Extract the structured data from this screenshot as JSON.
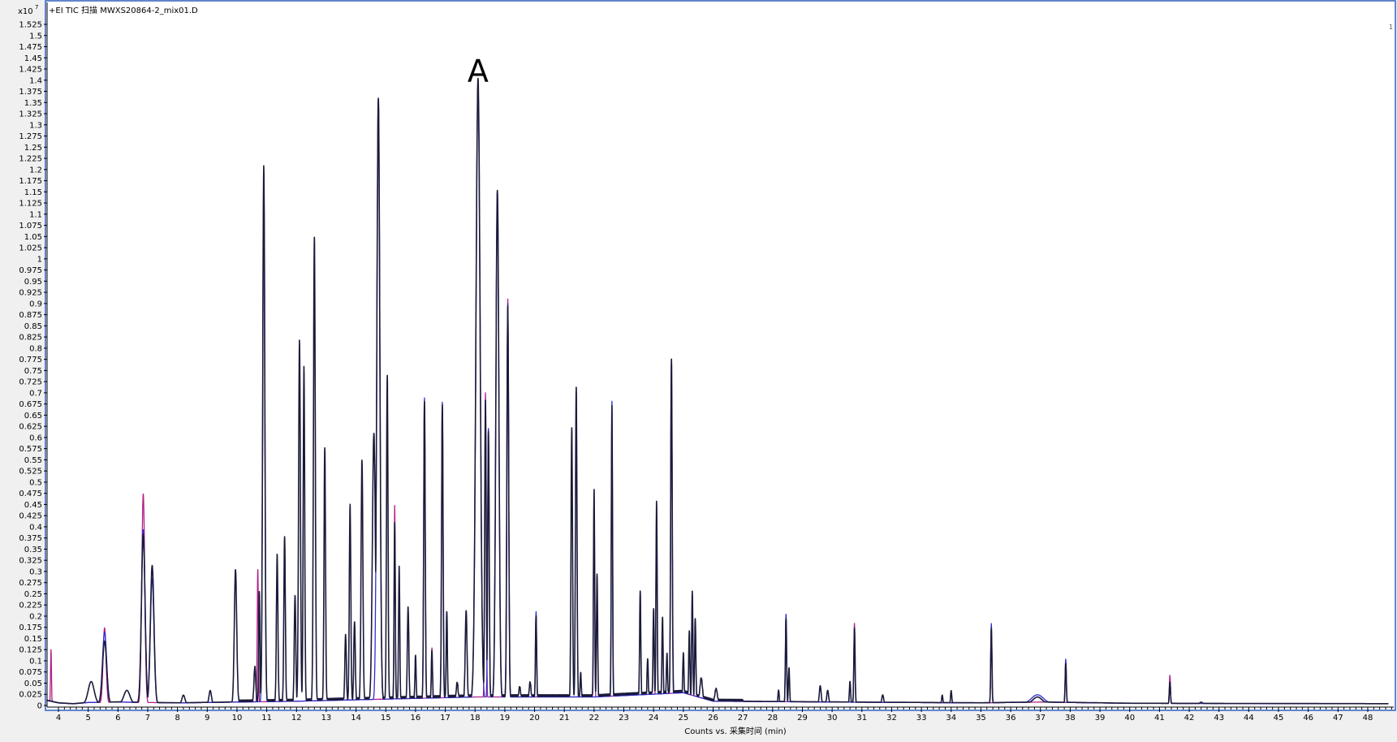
{
  "chart_data": {
    "type": "line",
    "title": "+EI TIC 扫描 MWXS20864-2_mix01.D",
    "xlabel": "Counts vs. 采集时间 (min)",
    "y_exponent_label": "x10",
    "y_exponent": "7",
    "corner_marker": "1",
    "annotation": {
      "text": "A",
      "x": 18.1
    },
    "xlim": [
      3.6,
      48.7
    ],
    "ylim": [
      0,
      1.55
    ],
    "x_ticks": [
      4,
      5,
      6,
      7,
      8,
      9,
      10,
      11,
      12,
      13,
      14,
      15,
      16,
      17,
      18,
      19,
      20,
      21,
      22,
      23,
      24,
      25,
      26,
      27,
      28,
      29,
      30,
      31,
      32,
      33,
      34,
      35,
      36,
      37,
      38,
      39,
      40,
      41,
      42,
      43,
      44,
      45,
      46,
      47,
      48
    ],
    "y_ticks": [
      "0",
      "0.025",
      "0.05",
      "0.075",
      "0.1",
      "0.125",
      "0.15",
      "0.175",
      "0.2",
      "0.225",
      "0.25",
      "0.275",
      "0.3",
      "0.325",
      "0.35",
      "0.375",
      "0.4",
      "0.425",
      "0.45",
      "0.475",
      "0.5",
      "0.525",
      "0.55",
      "0.575",
      "0.6",
      "0.625",
      "0.65",
      "0.675",
      "0.7",
      "0.725",
      "0.75",
      "0.775",
      "0.8",
      "0.825",
      "0.85",
      "0.875",
      "0.9",
      "0.925",
      "0.95",
      "0.975",
      "1",
      "1.025",
      "1.05",
      "1.075",
      "1.1",
      "1.125",
      "1.15",
      "1.175",
      "1.2",
      "1.225",
      "1.25",
      "1.275",
      "1.3",
      "1.325",
      "1.35",
      "1.375",
      "1.4",
      "1.425",
      "1.45",
      "1.475",
      "1.5",
      "1.525"
    ],
    "colors": {
      "trace_dark": "#1a1a3a",
      "trace_blue": "#2d2dcf",
      "trace_magenta": "#b0208a",
      "frame": "#3060c0"
    },
    "baseline": {
      "points": [
        [
          3.6,
          0.012
        ],
        [
          4.0,
          0.006
        ],
        [
          4.5,
          0.004
        ],
        [
          5.0,
          0.007
        ],
        [
          6.0,
          0.008
        ],
        [
          8.0,
          0.006
        ],
        [
          12.0,
          0.01
        ],
        [
          18.0,
          0.02
        ],
        [
          22.0,
          0.02
        ],
        [
          25.0,
          0.03
        ],
        [
          26.0,
          0.01
        ],
        [
          30.0,
          0.008
        ],
        [
          35.0,
          0.006
        ],
        [
          37.0,
          0.008
        ],
        [
          40.0,
          0.005
        ],
        [
          48.7,
          0.004
        ]
      ]
    },
    "series": [
      {
        "color_key": "trace_dark",
        "peaks": [
          [
            5.1,
            0.05,
            0.1
          ],
          [
            5.55,
            0.14,
            0.07
          ],
          [
            6.3,
            0.03,
            0.1
          ],
          [
            6.85,
            0.38,
            0.06
          ],
          [
            7.15,
            0.31,
            0.06
          ],
          [
            8.2,
            0.02,
            0.05
          ],
          [
            9.1,
            0.03,
            0.04
          ],
          [
            9.95,
            0.3,
            0.04
          ],
          [
            10.6,
            0.08,
            0.03
          ],
          [
            10.75,
            0.25,
            0.02
          ],
          [
            10.9,
            1.2,
            0.035
          ],
          [
            11.35,
            0.33,
            0.025
          ],
          [
            11.6,
            0.37,
            0.025
          ],
          [
            11.95,
            0.24,
            0.025
          ],
          [
            12.1,
            0.81,
            0.03
          ],
          [
            12.25,
            0.75,
            0.025
          ],
          [
            12.6,
            1.04,
            0.03
          ],
          [
            12.95,
            0.57,
            0.025
          ],
          [
            13.65,
            0.15,
            0.025
          ],
          [
            13.8,
            0.44,
            0.025
          ],
          [
            13.95,
            0.18,
            0.025
          ],
          [
            14.2,
            0.54,
            0.03
          ],
          [
            14.6,
            0.6,
            0.05
          ],
          [
            14.75,
            1.35,
            0.05
          ],
          [
            15.05,
            0.73,
            0.025
          ],
          [
            15.3,
            0.4,
            0.02
          ],
          [
            15.45,
            0.3,
            0.02
          ],
          [
            15.75,
            0.21,
            0.025
          ],
          [
            16.0,
            0.1,
            0.02
          ],
          [
            16.3,
            0.67,
            0.025
          ],
          [
            16.55,
            0.11,
            0.02
          ],
          [
            16.9,
            0.66,
            0.025
          ],
          [
            17.05,
            0.2,
            0.02
          ],
          [
            17.4,
            0.04,
            0.03
          ],
          [
            17.7,
            0.2,
            0.03
          ],
          [
            18.1,
            1.39,
            0.07
          ],
          [
            18.35,
            0.67,
            0.025
          ],
          [
            18.45,
            0.6,
            0.025
          ],
          [
            18.75,
            1.14,
            0.05
          ],
          [
            19.1,
            0.88,
            0.03
          ],
          [
            19.5,
            0.03,
            0.03
          ],
          [
            19.85,
            0.04,
            0.03
          ],
          [
            20.05,
            0.19,
            0.02
          ],
          [
            21.25,
            0.61,
            0.025
          ],
          [
            21.4,
            0.7,
            0.025
          ],
          [
            21.55,
            0.06,
            0.02
          ],
          [
            22.0,
            0.47,
            0.02
          ],
          [
            22.1,
            0.28,
            0.02
          ],
          [
            22.6,
            0.66,
            0.02
          ],
          [
            23.55,
            0.24,
            0.02
          ],
          [
            23.8,
            0.09,
            0.02
          ],
          [
            24.0,
            0.2,
            0.02
          ],
          [
            24.1,
            0.44,
            0.02
          ],
          [
            24.3,
            0.18,
            0.02
          ],
          [
            24.45,
            0.1,
            0.02
          ],
          [
            24.6,
            0.76,
            0.025
          ],
          [
            25.0,
            0.1,
            0.02
          ],
          [
            25.2,
            0.15,
            0.02
          ],
          [
            25.3,
            0.24,
            0.02
          ],
          [
            25.4,
            0.18,
            0.02
          ],
          [
            25.6,
            0.05,
            0.04
          ],
          [
            26.1,
            0.03,
            0.04
          ],
          [
            28.2,
            0.03,
            0.02
          ],
          [
            28.45,
            0.19,
            0.02
          ],
          [
            28.55,
            0.08,
            0.02
          ],
          [
            29.6,
            0.04,
            0.03
          ],
          [
            29.85,
            0.03,
            0.03
          ],
          [
            30.6,
            0.05,
            0.02
          ],
          [
            30.75,
            0.17,
            0.02
          ],
          [
            31.7,
            0.02,
            0.03
          ],
          [
            33.7,
            0.02,
            0.02
          ],
          [
            34.0,
            0.03,
            0.02
          ],
          [
            35.35,
            0.17,
            0.02
          ],
          [
            36.9,
            0.015,
            0.15
          ],
          [
            37.85,
            0.09,
            0.02
          ],
          [
            41.35,
            0.05,
            0.02
          ],
          [
            42.4,
            0.005,
            0.05
          ]
        ]
      },
      {
        "color_key": "trace_blue",
        "peaks": [
          [
            5.55,
            0.16,
            0.07
          ],
          [
            6.85,
            0.39,
            0.06
          ],
          [
            7.15,
            0.28,
            0.06
          ],
          [
            10.9,
            1.19,
            0.035
          ],
          [
            14.75,
            1.35,
            0.05
          ],
          [
            16.3,
            0.68,
            0.025
          ],
          [
            16.9,
            0.67,
            0.025
          ],
          [
            18.1,
            1.38,
            0.07
          ],
          [
            18.45,
            0.61,
            0.025
          ],
          [
            18.75,
            1.14,
            0.05
          ],
          [
            19.1,
            0.89,
            0.03
          ],
          [
            20.05,
            0.2,
            0.02
          ],
          [
            22.6,
            0.67,
            0.02
          ],
          [
            24.6,
            0.76,
            0.025
          ],
          [
            25.3,
            0.24,
            0.02
          ],
          [
            28.45,
            0.2,
            0.02
          ],
          [
            35.35,
            0.18,
            0.02
          ],
          [
            37.85,
            0.1,
            0.02
          ],
          [
            36.9,
            0.02,
            0.2
          ],
          [
            41.35,
            0.04,
            0.02
          ]
        ]
      },
      {
        "color_key": "trace_magenta",
        "peaks": [
          [
            3.75,
            0.12,
            0.015
          ],
          [
            5.55,
            0.17,
            0.05
          ],
          [
            6.85,
            0.47,
            0.05
          ],
          [
            10.7,
            0.3,
            0.02
          ],
          [
            15.3,
            0.44,
            0.02
          ],
          [
            16.55,
            0.12,
            0.02
          ],
          [
            18.35,
            0.69,
            0.025
          ],
          [
            19.1,
            0.9,
            0.03
          ],
          [
            22.0,
            0.47,
            0.02
          ],
          [
            24.1,
            0.44,
            0.02
          ],
          [
            30.75,
            0.18,
            0.02
          ],
          [
            41.35,
            0.065,
            0.02
          ]
        ]
      }
    ]
  }
}
